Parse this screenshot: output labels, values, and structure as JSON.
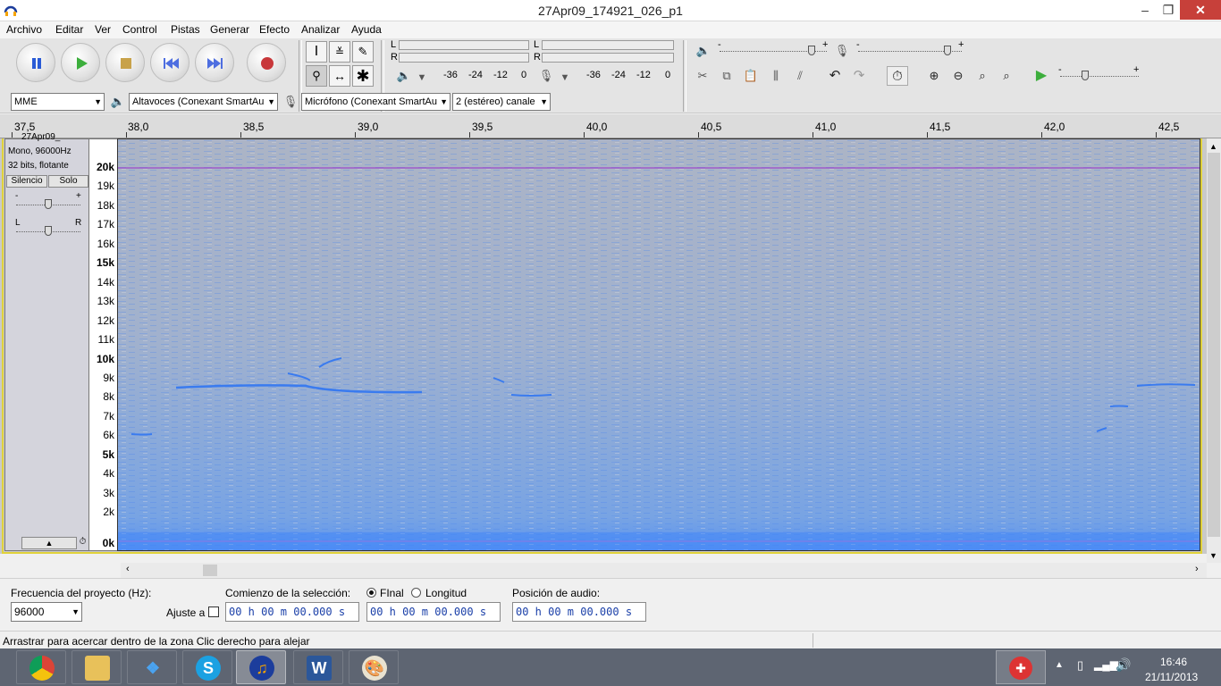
{
  "window": {
    "title": "27Apr09_174921_026_p1",
    "minimize": "‒",
    "maximize": "❐",
    "close": "✕"
  },
  "menu": [
    "Archivo",
    "Editar",
    "Ver",
    "Control",
    "Pistas",
    "Generar",
    "Efecto",
    "Analizar",
    "Ayuda"
  ],
  "meters": {
    "playback": {
      "left": "L",
      "right": "R",
      "ticks": [
        "-36",
        "-24",
        "-12",
        "0"
      ]
    },
    "record": {
      "left": "L",
      "right": "R",
      "ticks": [
        "-36",
        "-24",
        "-12",
        "0"
      ]
    }
  },
  "sliders": {
    "output_volume": {
      "min": "-",
      "max": "+",
      "level": 0.86
    },
    "input_volume": {
      "min": "-",
      "max": "+",
      "level": 0.86
    },
    "play_speed": {
      "min": "-",
      "max": "+",
      "level": 0.32
    }
  },
  "device_bar": {
    "host": "MME",
    "output": "Altavoces (Conexant SmartAu",
    "input": "Micrófono (Conexant SmartAu",
    "channels": "2 (estéreo) canale"
  },
  "ruler": {
    "labels": [
      "37,5",
      "38,0",
      "38,5",
      "39,0",
      "39,5",
      "40,0",
      "40,5",
      "41,0",
      "41,5",
      "42,0",
      "42,5"
    ]
  },
  "track": {
    "name": "27Apr09_",
    "format": "Mono, 96000Hz",
    "bits": "32 bits, flotante",
    "mute_label": "Silencio",
    "solo_label": "Solo",
    "gain": {
      "min": "-",
      "max": "+",
      "level": 0.5
    },
    "pan": {
      "left": "L",
      "right": "R",
      "level": 0.5
    }
  },
  "freq_axis": [
    {
      "label": "20k",
      "bold": true
    },
    {
      "label": "19k"
    },
    {
      "label": "18k"
    },
    {
      "label": "17k"
    },
    {
      "label": "16k"
    },
    {
      "label": "15k",
      "bold": true
    },
    {
      "label": "14k"
    },
    {
      "label": "13k"
    },
    {
      "label": "12k"
    },
    {
      "label": "11k"
    },
    {
      "label": "10k",
      "bold": true
    },
    {
      "label": "9k"
    },
    {
      "label": "8k"
    },
    {
      "label": "7k"
    },
    {
      "label": "6k"
    },
    {
      "label": "5k",
      "bold": true
    },
    {
      "label": "4k"
    },
    {
      "label": "3k"
    },
    {
      "label": "2k"
    },
    {
      "label": "0k",
      "bold": true
    }
  ],
  "colors": {
    "spectrogram_base": "#a9b4c8",
    "accent_line": "#9b2fc9",
    "selection_frame": "#e0d23a"
  },
  "selection_bar": {
    "project_rate_label": "Frecuencia del proyecto (Hz):",
    "project_rate": "96000",
    "snap_label": "Ajuste a",
    "start_label": "Comienzo de la selección:",
    "end_radio": "FInal",
    "length_radio": "Longitud",
    "position_label": "Posición de audio:",
    "start_time": "00 h 00 m 00.000 s",
    "end_time": "00 h 00 m 00.000 s",
    "position_time": "00 h 00 m 00.000 s"
  },
  "status": "Arrastrar para acercar dentro de la zona Clic derecho para alejar",
  "taskbar": {
    "apps": [
      "chrome-icon",
      "file-explorer-icon",
      "dropbox-icon",
      "skype-icon",
      "audacity-icon",
      "word-icon",
      "paint-icon"
    ],
    "time": "16:46",
    "date": "21/11/2013"
  }
}
